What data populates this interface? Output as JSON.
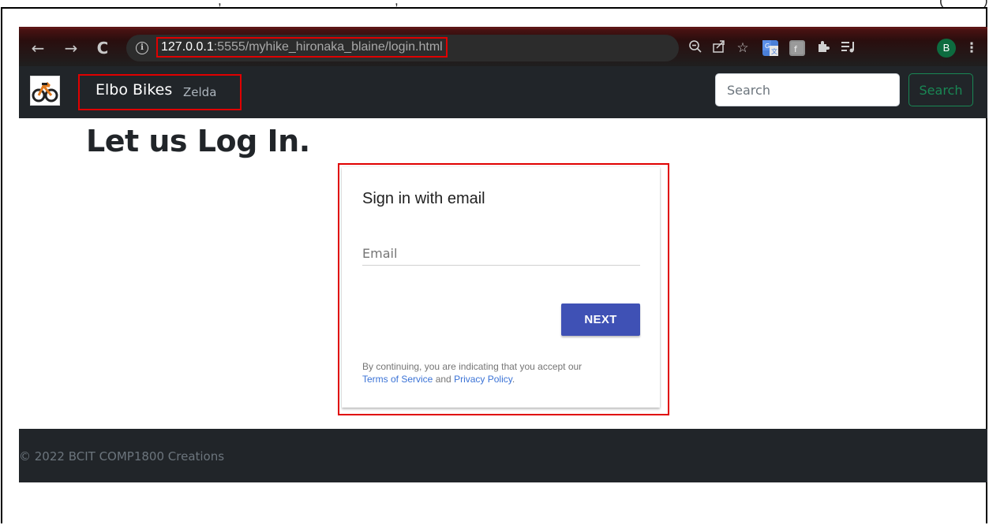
{
  "browser": {
    "url_host": "127.0.0.1",
    "url_rest": ":5555/myhike_hironaka_blaine/login.html",
    "profile_initial": "B",
    "icons": [
      "back-icon",
      "forward-icon",
      "reload-icon",
      "site-info-icon",
      "zoom-out-icon",
      "share-icon",
      "bookmark-star-icon",
      "google-translate-icon",
      "extension-icon",
      "puzzle-extensions-icon",
      "reading-list-icon",
      "profile-avatar",
      "more-menu-icon"
    ]
  },
  "navbar": {
    "brand": "Elbo Bikes",
    "user_name": "Zelda",
    "search_placeholder": "Search",
    "search_button": "Search",
    "colors": {
      "background": "#212529",
      "search_button": "#198754"
    }
  },
  "page": {
    "title": "Let us Log In."
  },
  "signin": {
    "title": "Sign in with email",
    "email_placeholder": "Email",
    "next_button": "NEXT",
    "legal_prefix": "By continuing, you are indicating that you accept our",
    "terms_link": "Terms of Service",
    "legal_and": " and ",
    "privacy_link": "Privacy Policy",
    "legal_end": ".",
    "colors": {
      "next_button": "#3f51b5",
      "link": "#3b73d6",
      "highlight": "#e00000"
    }
  },
  "footer": {
    "text": "© 2022 BCIT COMP1800 Creations"
  }
}
